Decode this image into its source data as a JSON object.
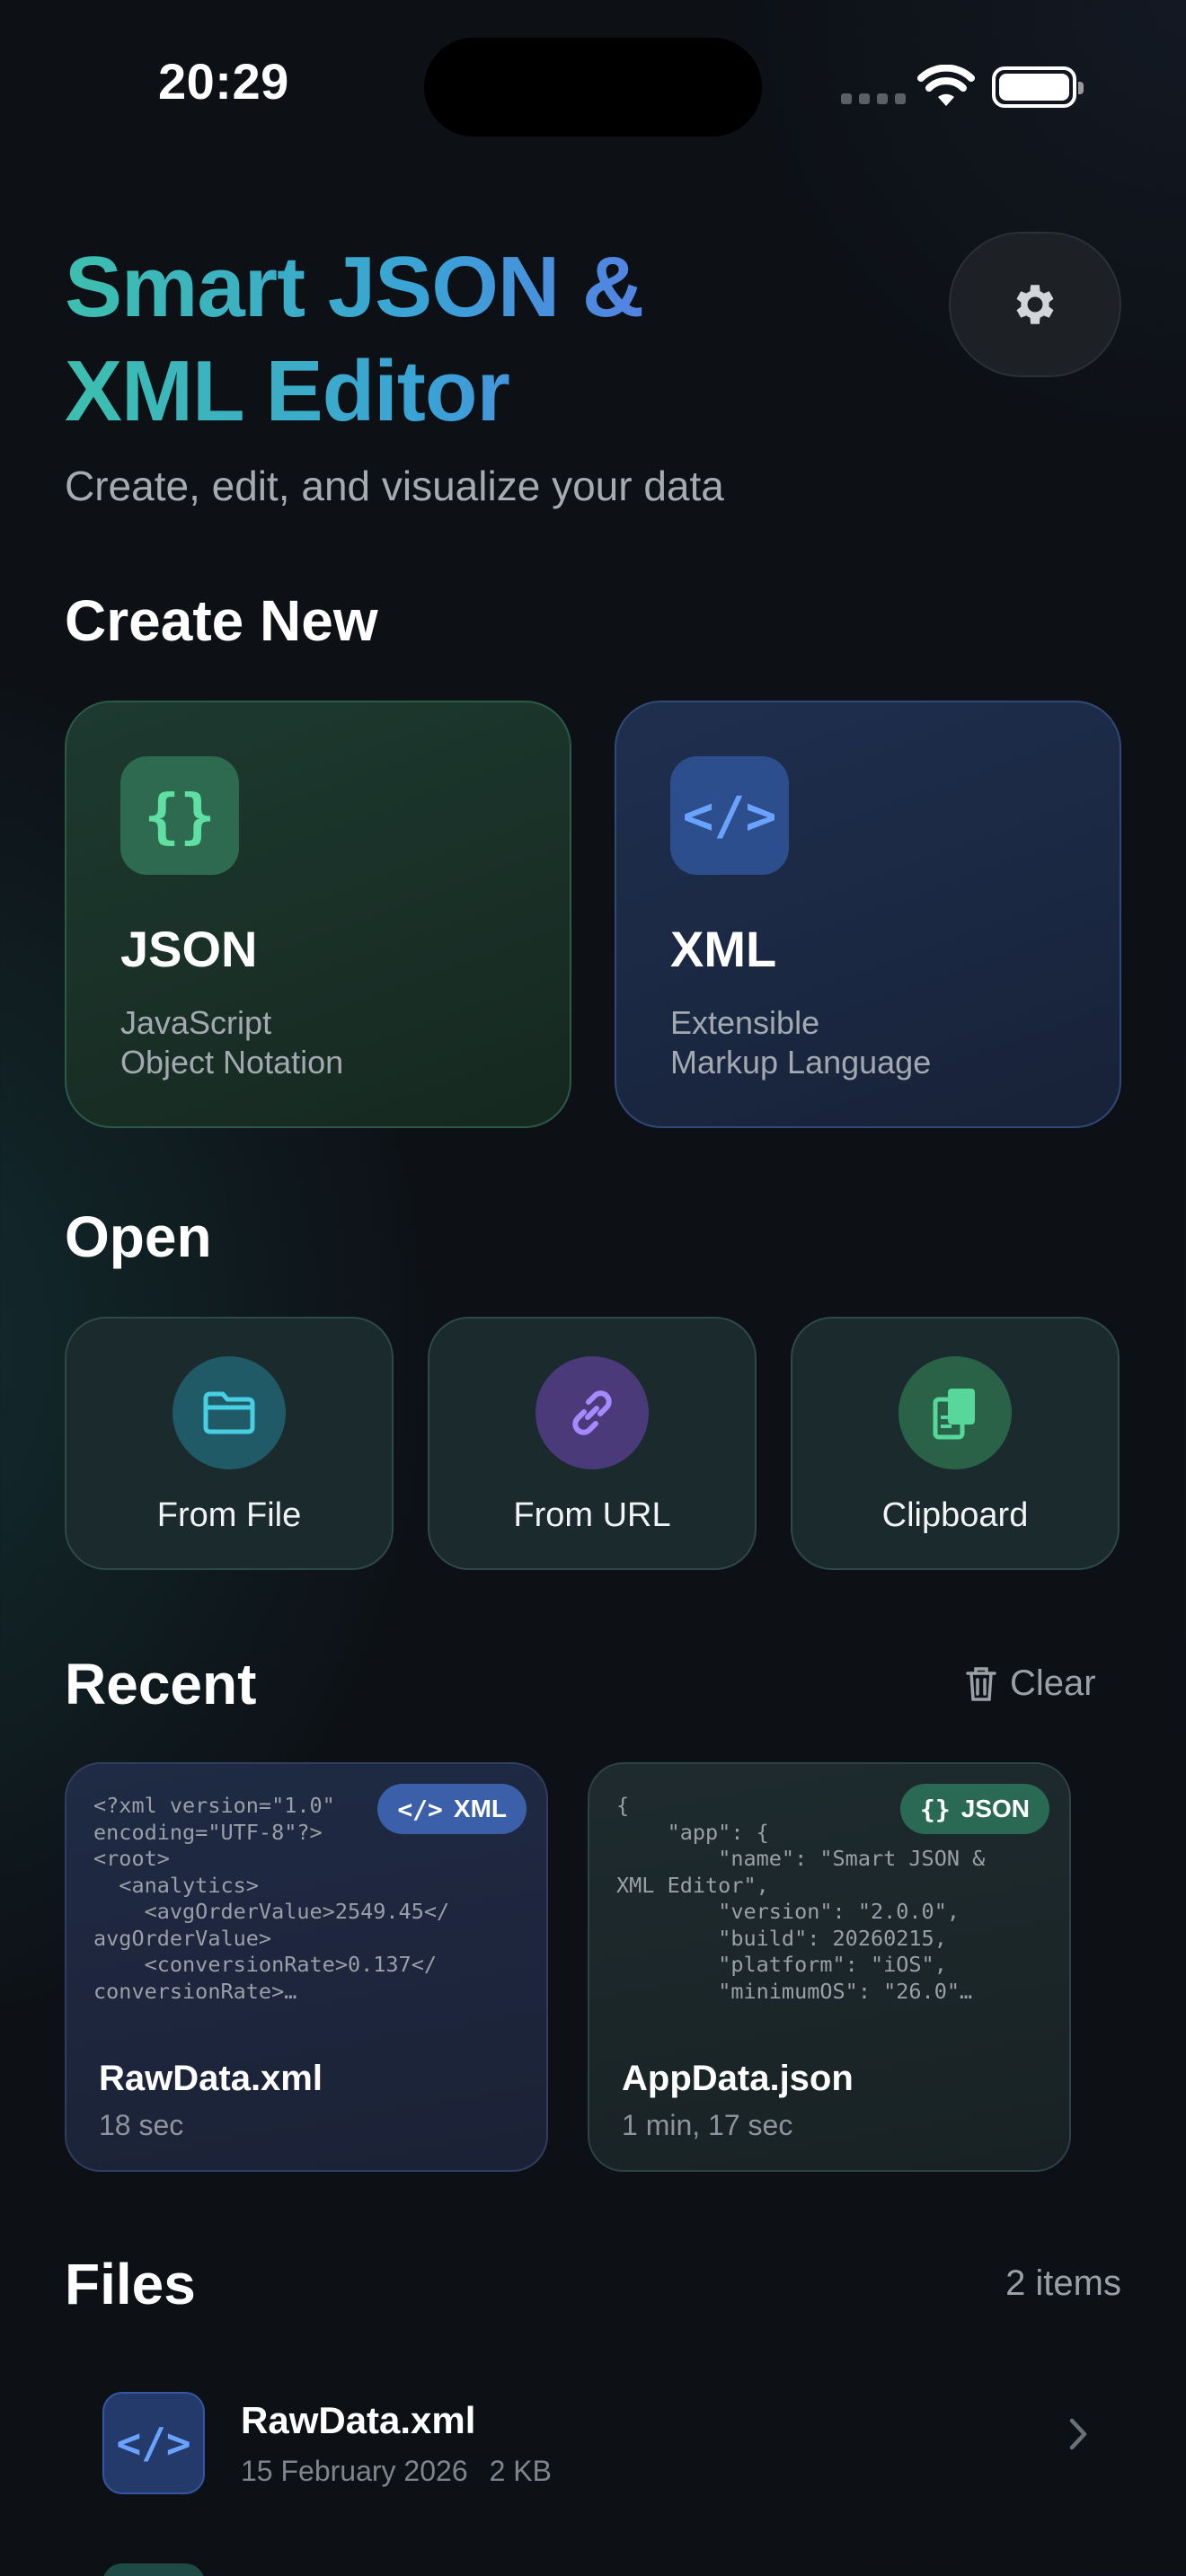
{
  "status_bar": {
    "time": "20:29"
  },
  "header": {
    "title": "Smart JSON & XML Editor",
    "subtitle": "Create, edit, and visualize your data"
  },
  "create_new": {
    "title": "Create New",
    "cards": [
      {
        "name": "JSON",
        "icon_glyph": "{}",
        "icon": "curly-braces-icon",
        "desc_line1": "JavaScript",
        "desc_line2": "Object Notation",
        "accent": "#5fe0a2"
      },
      {
        "name": "XML",
        "icon_glyph": "</>",
        "icon": "code-tag-icon",
        "desc_line1": "Extensible",
        "desc_line2": "Markup Language",
        "accent": "#6aa3ff"
      }
    ]
  },
  "open": {
    "title": "Open",
    "tiles": [
      {
        "label": "From File",
        "icon": "folder-icon",
        "color": "#3fc6d6"
      },
      {
        "label": "From URL",
        "icon": "link-icon",
        "color": "#9b7cf0"
      },
      {
        "label": "Clipboard",
        "icon": "clipboard-icon",
        "color": "#4fd394"
      }
    ]
  },
  "recent": {
    "title": "Recent",
    "clear_label": "Clear",
    "items": [
      {
        "name": "RawData.xml",
        "time": "18 sec",
        "badge": "XML",
        "badge_glyph": "</>",
        "preview": "<?xml version=\"1.0\"\nencoding=\"UTF-8\"?>\n<root>\n  <analytics>\n    <avgOrderValue>2549.45</\navgOrderValue>\n    <conversionRate>0.137</\nconversionRate>…"
      },
      {
        "name": "AppData.json",
        "time": "1 min, 17 sec",
        "badge": "JSON",
        "badge_glyph": "{}",
        "preview": "{\n    \"app\": {\n        \"name\": \"Smart JSON &\nXML Editor\",\n        \"version\": \"2.0.0\",\n        \"build\": 20260215,\n        \"platform\": \"iOS\",\n        \"minimumOS\": \"26.0\"…"
      }
    ]
  },
  "files": {
    "title": "Files",
    "count": "2 items",
    "rows": [
      {
        "name": "RawData.xml",
        "date": "15 February 2026",
        "size": "2 KB",
        "icon_glyph": "</>"
      }
    ]
  }
}
